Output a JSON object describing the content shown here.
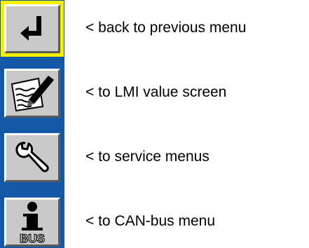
{
  "colors": {
    "sidebar": "#1458a8",
    "button_face": "#c9c9c9",
    "selection": "#f5f000",
    "text": "#000000"
  },
  "menu": {
    "items": [
      {
        "icon": "return-arrow-icon",
        "label": "< back to previous menu",
        "selected": true
      },
      {
        "icon": "pen-on-paper-icon",
        "label": "< to LMI value screen",
        "selected": false
      },
      {
        "icon": "wrench-icon",
        "label": "< to service menus",
        "selected": false
      },
      {
        "icon": "info-bus-icon",
        "label": "< to CAN-bus menu",
        "selected": false,
        "icon_text": "BUS"
      }
    ]
  }
}
